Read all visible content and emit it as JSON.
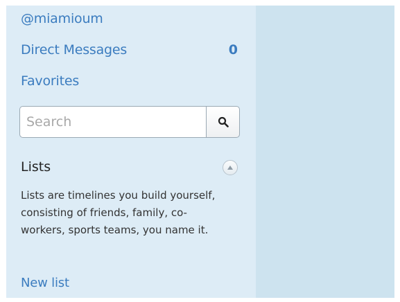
{
  "sidebar": {
    "username": "@miamioum",
    "direct_messages": {
      "label": "Direct Messages",
      "count": "0"
    },
    "favorites": "Favorites",
    "search": {
      "placeholder": "Search",
      "value": ""
    },
    "lists": {
      "title": "Lists",
      "description": "Lists are timelines you build yourself, consisting of friends, family, co-workers, sports teams, you name it.",
      "new_list": "New list"
    }
  },
  "colors": {
    "link": "#3b7cbf",
    "sidebar_bg": "#ddecf6",
    "main_bg": "#cde3ef"
  },
  "icons": {
    "search_button": "search-icon",
    "lists_toggle": "chevron-up-icon"
  }
}
